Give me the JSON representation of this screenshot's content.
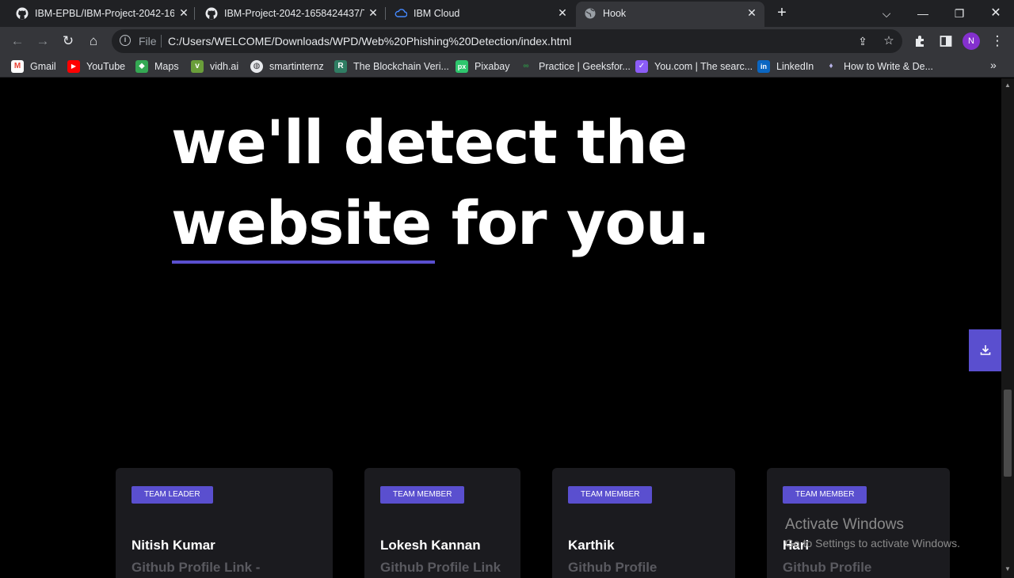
{
  "browser": {
    "tabs": [
      {
        "title": "IBM-EPBL/IBM-Project-2042-165",
        "icon": "github-icon"
      },
      {
        "title": "IBM-Project-2042-1658424437/T",
        "icon": "github-icon"
      },
      {
        "title": "IBM Cloud",
        "icon": "ibm-cloud-icon"
      },
      {
        "title": "Hook",
        "icon": "globe-icon",
        "active": true
      }
    ],
    "address": {
      "scheme_label": "File",
      "url": "C:/Users/WELCOME/Downloads/WPD/Web%20Phishing%20Detection/index.html"
    },
    "profile_initial": "N",
    "bookmarks": [
      {
        "label": "Gmail",
        "icon": "gmail-icon"
      },
      {
        "label": "YouTube",
        "icon": "youtube-icon"
      },
      {
        "label": "Maps",
        "icon": "maps-icon"
      },
      {
        "label": "vidh.ai",
        "icon": "vidhai-icon"
      },
      {
        "label": "smartinternz",
        "icon": "globe-icon"
      },
      {
        "label": "The Blockchain Veri...",
        "icon": "blockchain-icon"
      },
      {
        "label": "Pixabay",
        "icon": "pixabay-icon"
      },
      {
        "label": "Practice | Geeksfor...",
        "icon": "geeksforgeeks-icon"
      },
      {
        "label": "You.com | The searc...",
        "icon": "youcom-icon"
      },
      {
        "label": "LinkedIn",
        "icon": "linkedin-icon"
      },
      {
        "label": "How to Write & De...",
        "icon": "ethereum-icon"
      }
    ]
  },
  "page": {
    "hero": {
      "line1": "we'll detect the",
      "line2": "website for you."
    },
    "team": [
      {
        "role": "TEAM LEADER",
        "name": "Nitish Kumar",
        "link": "Github Profile Link -"
      },
      {
        "role": "TEAM MEMBER",
        "name": "Lokesh Kannan",
        "link": "Github Profile Link"
      },
      {
        "role": "TEAM MEMBER",
        "name": "Karthik",
        "link": "Github Profile"
      },
      {
        "role": "TEAM MEMBER",
        "name": "Hari",
        "link": "Github Profile"
      }
    ]
  },
  "overlay": {
    "activate_title": "Activate Windows",
    "activate_sub": "Go to Settings to activate Windows."
  },
  "colors": {
    "accent": "#5a4fcf",
    "card_bg": "#1b1b1f",
    "page_bg": "#000000"
  }
}
